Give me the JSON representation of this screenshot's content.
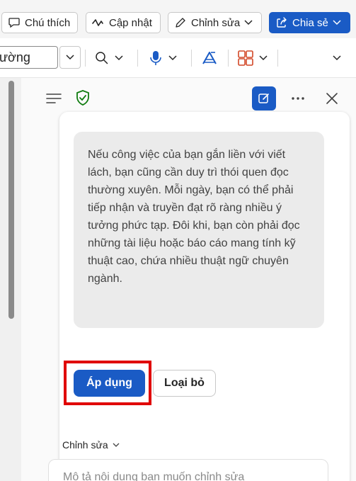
{
  "toolbar": {
    "comments_label": "Chú thích",
    "catchup_label": "Cập nhật",
    "editing_label": "Chỉnh sửa",
    "share_label": "Chia sẻ",
    "share_color": "#1a5bc5"
  },
  "ribbon": {
    "style_value": "ường"
  },
  "pane": {
    "suggestion_text": "Nếu công việc của bạn gắn liền với viết lách, bạn cũng cần duy trì thói quen đọc thường xuyên. Mỗi ngày, bạn có thể phải tiếp nhận và truyền đạt rõ ràng nhiều ý tưởng phức tạp. Đôi khi, bạn còn phải đọc những tài liệu hoặc báo cáo mang tính kỹ thuật cao, chứa nhiều thuật ngữ chuyên ngành.",
    "apply_label": "Áp dụng",
    "discard_label": "Loại bỏ",
    "edit_section_label": "Chỉnh sửa",
    "prompt_placeholder": "Mô tả nội dung bạn muốn chỉnh sửa",
    "accent_color": "#1a5bc5",
    "highlight_color": "#e00000"
  },
  "icons": [
    "comment-icon",
    "catchup-icon",
    "pen-icon",
    "share-icon",
    "search-icon",
    "microphone-icon",
    "editor-icon",
    "grid-icon",
    "menu-icon",
    "shield-icon",
    "new-chat-icon",
    "more-icon",
    "close-icon"
  ]
}
